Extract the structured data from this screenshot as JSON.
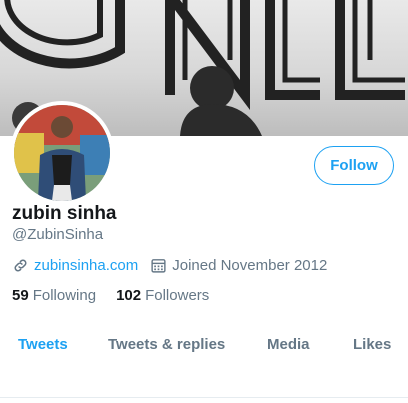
{
  "profile": {
    "name": "zubin sinha",
    "handle": "@ZubinSinha",
    "website": "zubinsinha.com",
    "joined": "Joined November 2012",
    "follow_label": "Follow"
  },
  "stats": {
    "following_count": "59",
    "following_label": "Following",
    "followers_count": "102",
    "followers_label": "Followers"
  },
  "tabs": [
    {
      "label": "Tweets",
      "active": true
    },
    {
      "label": "Tweets & replies",
      "active": false
    },
    {
      "label": "Media",
      "active": false
    },
    {
      "label": "Likes",
      "active": false
    }
  ],
  "colors": {
    "accent": "#1da1f2",
    "muted": "#657786",
    "text": "#14171a"
  },
  "icons": {
    "website": "link-icon",
    "joined": "calendar-icon"
  }
}
